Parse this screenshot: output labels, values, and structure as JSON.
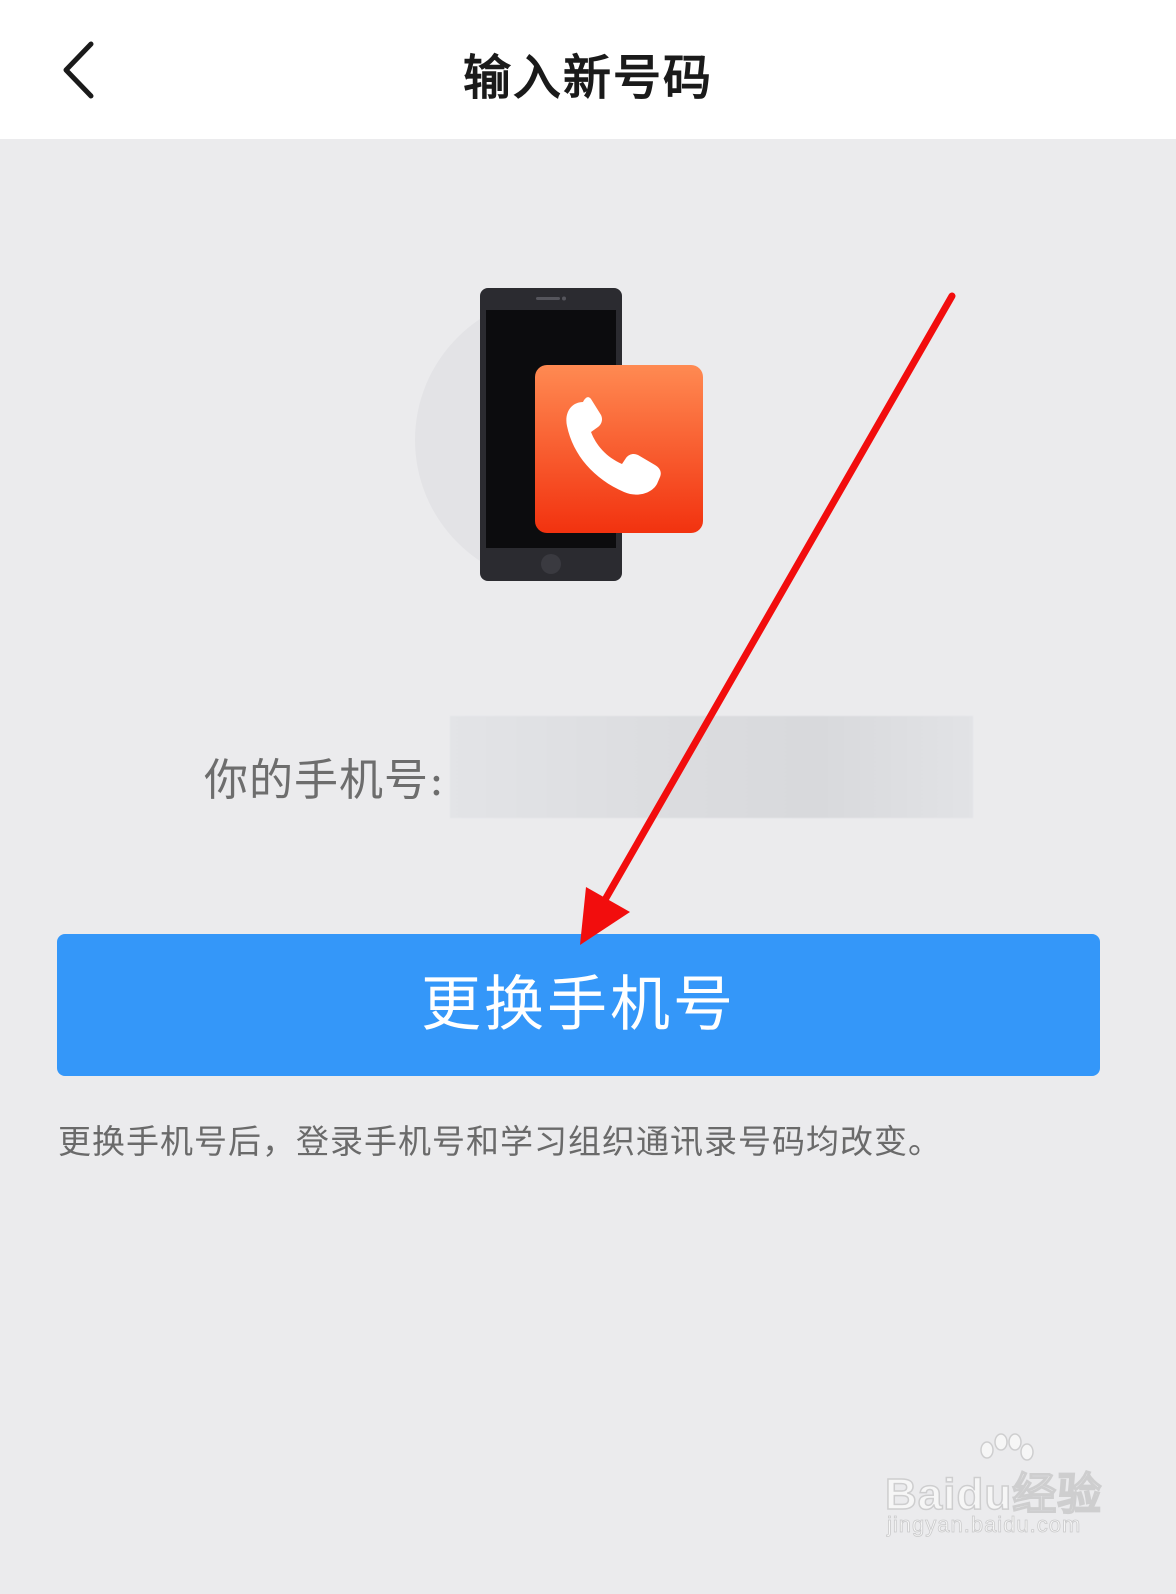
{
  "header": {
    "title": "输入新号码",
    "back_icon": "chevron-left-icon"
  },
  "illustration": {
    "icon": "phone-call-icon",
    "colors": {
      "phone_body": "#2b2b30",
      "badge_top": "#ff8a52",
      "badge_bottom": "#f2320f"
    }
  },
  "phone_info": {
    "label": "你的手机号:",
    "value_redacted": true
  },
  "change_button": {
    "label": "更换手机号",
    "color": "#3497f9"
  },
  "hint": "更换手机号后，登录手机号和学习组织通讯录号码均改变。",
  "annotation": {
    "type": "arrow",
    "color": "#ff0000"
  },
  "watermark": {
    "brand": "Baidu经验",
    "url": "jingyan.baidu.com"
  }
}
